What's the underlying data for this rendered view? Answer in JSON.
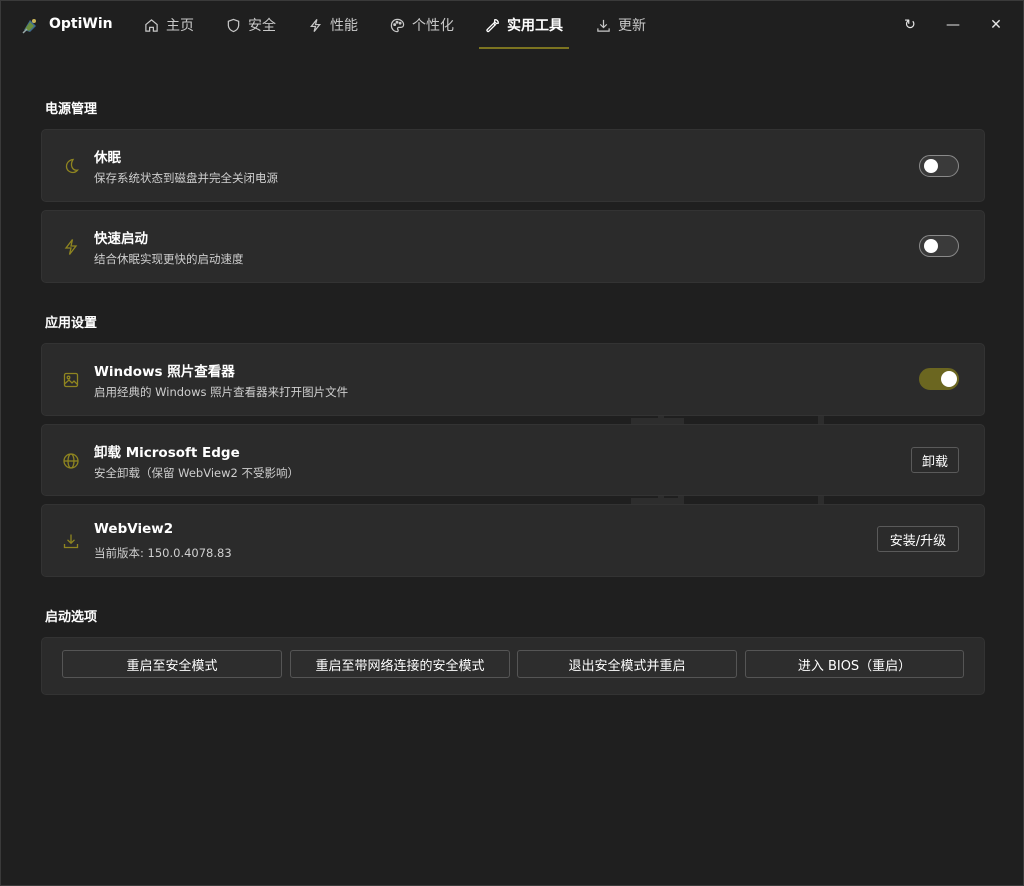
{
  "app": {
    "title": "OptiWin"
  },
  "nav": {
    "tabs": [
      {
        "label": "主页",
        "icon": "home-icon"
      },
      {
        "label": "安全",
        "icon": "shield-icon"
      },
      {
        "label": "性能",
        "icon": "lightning-icon"
      },
      {
        "label": "个性化",
        "icon": "palette-icon"
      },
      {
        "label": "实用工具",
        "icon": "wrench-icon",
        "active": true
      },
      {
        "label": "更新",
        "icon": "download-icon"
      }
    ]
  },
  "window_controls": {
    "refresh": "↻",
    "minimize": "—",
    "close": "✕"
  },
  "colors": {
    "accent": "#7c7420",
    "toggle_on": "#6b6620",
    "icon": "#8f8520",
    "background": "#1f1f1f",
    "card": "#2b2b2b"
  },
  "power": {
    "section_title": "电源管理",
    "hibernate": {
      "title": "休眠",
      "desc": "保存系统状态到磁盘并完全关闭电源",
      "icon": "moon-icon",
      "enabled": false
    },
    "fast_startup": {
      "title": "快速启动",
      "desc": "结合休眠实现更快的启动速度",
      "icon": "lightning-icon",
      "enabled": false
    }
  },
  "apps": {
    "section_title": "应用设置",
    "photo_viewer": {
      "title": "Windows 照片查看器",
      "desc": "启用经典的 Windows 照片查看器来打开图片文件",
      "icon": "image-icon",
      "enabled": true
    },
    "edge": {
      "title": "卸载 Microsoft Edge",
      "desc": "安全卸载（保留 WebView2 不受影响）",
      "icon": "globe-icon",
      "button": "卸载"
    },
    "webview": {
      "title": "WebView2",
      "desc": "当前版本: 150.0.4078.83",
      "icon": "download-icon",
      "button": "安装/升级"
    }
  },
  "boot": {
    "section_title": "启动选项",
    "buttons": [
      "重启至安全模式",
      "重启至带网络连接的安全模式",
      "退出安全模式并重启",
      "进入 BIOS（重启）"
    ]
  }
}
